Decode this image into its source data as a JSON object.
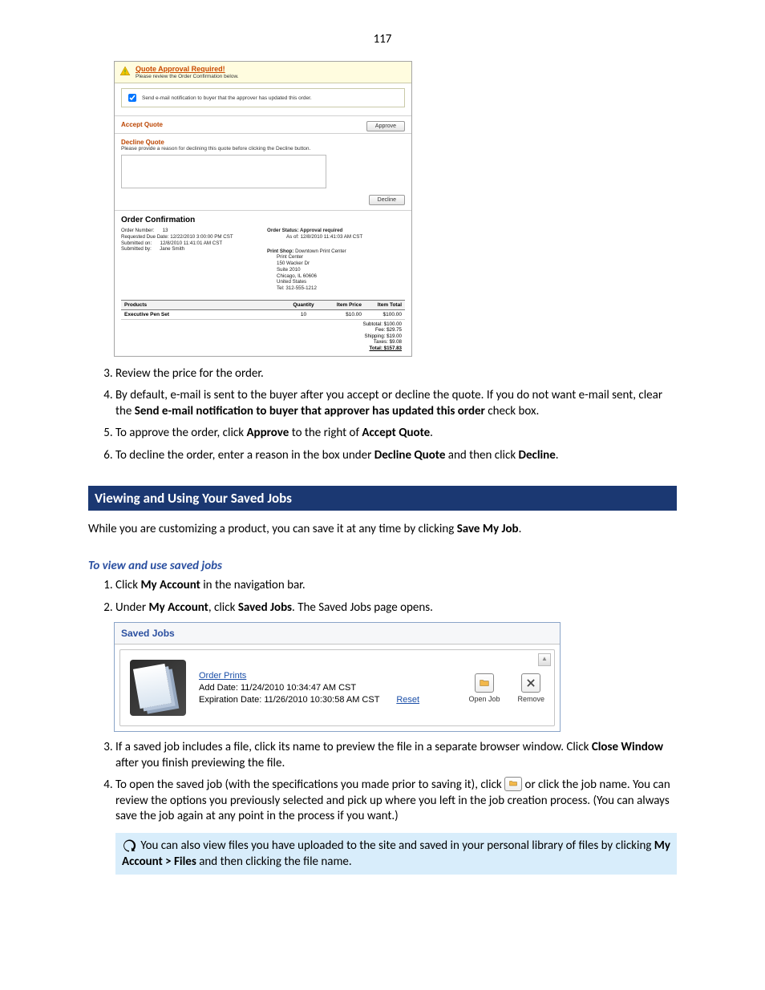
{
  "page_number": "117",
  "quote": {
    "alert_title": "Quote Approval Required!",
    "alert_sub": "Please review the Order Confirmation below.",
    "sendmail_label": "Send e-mail notification to buyer that the approver has updated this order.",
    "sendmail_checked": true,
    "accept_title": "Accept Quote",
    "approve_btn": "Approve",
    "decline_title": "Decline Quote",
    "decline_hint": "Please provide a reason for declining this quote before clicking the Decline button.",
    "decline_btn": "Decline",
    "order_conf_title": "Order Confirmation",
    "left": {
      "order_number_lbl": "Order Number:",
      "order_number": "13",
      "requested_due_lbl": "Requested Due Date:",
      "requested_due": "12/22/2010 3:00:00 PM CST",
      "submitted_on_lbl": "Submitted on:",
      "submitted_on": "12/8/2010 11:41:01 AM CST",
      "submitted_by_lbl": "Submitted by:",
      "submitted_by": "Jane Smith"
    },
    "right": {
      "status_lbl": "Order Status:",
      "status": "Approval required",
      "asof_lbl": "As of:",
      "asof": "12/8/2010 11:41:03 AM CST"
    },
    "print_shop": {
      "lbl": "Print Shop:",
      "name": "Downtown Print Center",
      "addr1": "Print Center",
      "addr2": "150 Wacker Dr",
      "addr3": "Suite 2010",
      "addr4": "Chicago, IL 60606",
      "addr5": "United States",
      "tel": "Tel: 312-555-1212"
    },
    "table": {
      "h_products": "Products",
      "h_qty": "Quantity",
      "h_price": "Item Price",
      "h_total": "Item Total",
      "row_name": "Executive Pen Set",
      "row_qty": "10",
      "row_price": "$10.00",
      "row_total": "$100.00"
    },
    "totals": {
      "subtotal": "Subtotal: $100.00",
      "fee": "Fee: $29.75",
      "shipping": "Shipping: $19.00",
      "taxes": "Taxes: $9.08",
      "total": "Total: $157.83"
    }
  },
  "instr1": {
    "step3": "Review the price for the order.",
    "step4_a": "By default, e-mail is sent to the buyer after you accept or decline the quote. If you do not want e-mail sent, clear the ",
    "step4_bold": "Send e-mail notification to buyer that approver has updated this order",
    "step4_b": " check box.",
    "step5_a": "To approve the order, click ",
    "step5_b1": "Approve",
    "step5_c": " to the right of ",
    "step5_b2": "Accept Quote",
    "step5_d": ".",
    "step6_a": "To decline the order, enter a reason in the box under ",
    "step6_b1": "Decline Quote",
    "step6_c": " and then click ",
    "step6_b2": "Decline",
    "step6_d": "."
  },
  "section_title": "Viewing and Using Your Saved Jobs",
  "section_para_a": "While you are customizing a product, you can save it at any time by clicking ",
  "section_para_b": "Save My Job",
  "section_para_c": ".",
  "subhead": "To view and use saved jobs",
  "instr2": {
    "s1_a": "Click ",
    "s1_b": "My Account",
    "s1_c": " in the navigation bar.",
    "s2_a": "Under ",
    "s2_b": "My Account",
    "s2_c": ", click ",
    "s2_b2": "Saved Jobs",
    "s2_d": ". The Saved Jobs page opens."
  },
  "saved": {
    "header": "Saved Jobs",
    "job_name": "Order Prints",
    "add_date": "Add Date: 11/24/2010 10:34:47 AM CST",
    "exp_date": "Expiration Date: 11/26/2010 10:30:58 AM CST",
    "reset": "Reset",
    "open": "Open Job",
    "remove": "Remove"
  },
  "instr3": {
    "s3_a": "If a saved job includes a file, click its name to preview the file in a separate browser window. Click ",
    "s3_b": "Close Window",
    "s3_c": " after you finish previewing the file.",
    "s4_a": "To open the saved job (with the specifications you made prior to saving it), click ",
    "s4_b": " or click the job name. You can review the options you previously selected and pick up where you left in the job creation process. (You can always save the job again at any point in the process if you want.)"
  },
  "tip": {
    "text_a": " You can also view files you have uploaded to the site and saved in your personal library of files by clicking ",
    "text_b": "My Account > Files",
    "text_c": " and then clicking the file name."
  }
}
